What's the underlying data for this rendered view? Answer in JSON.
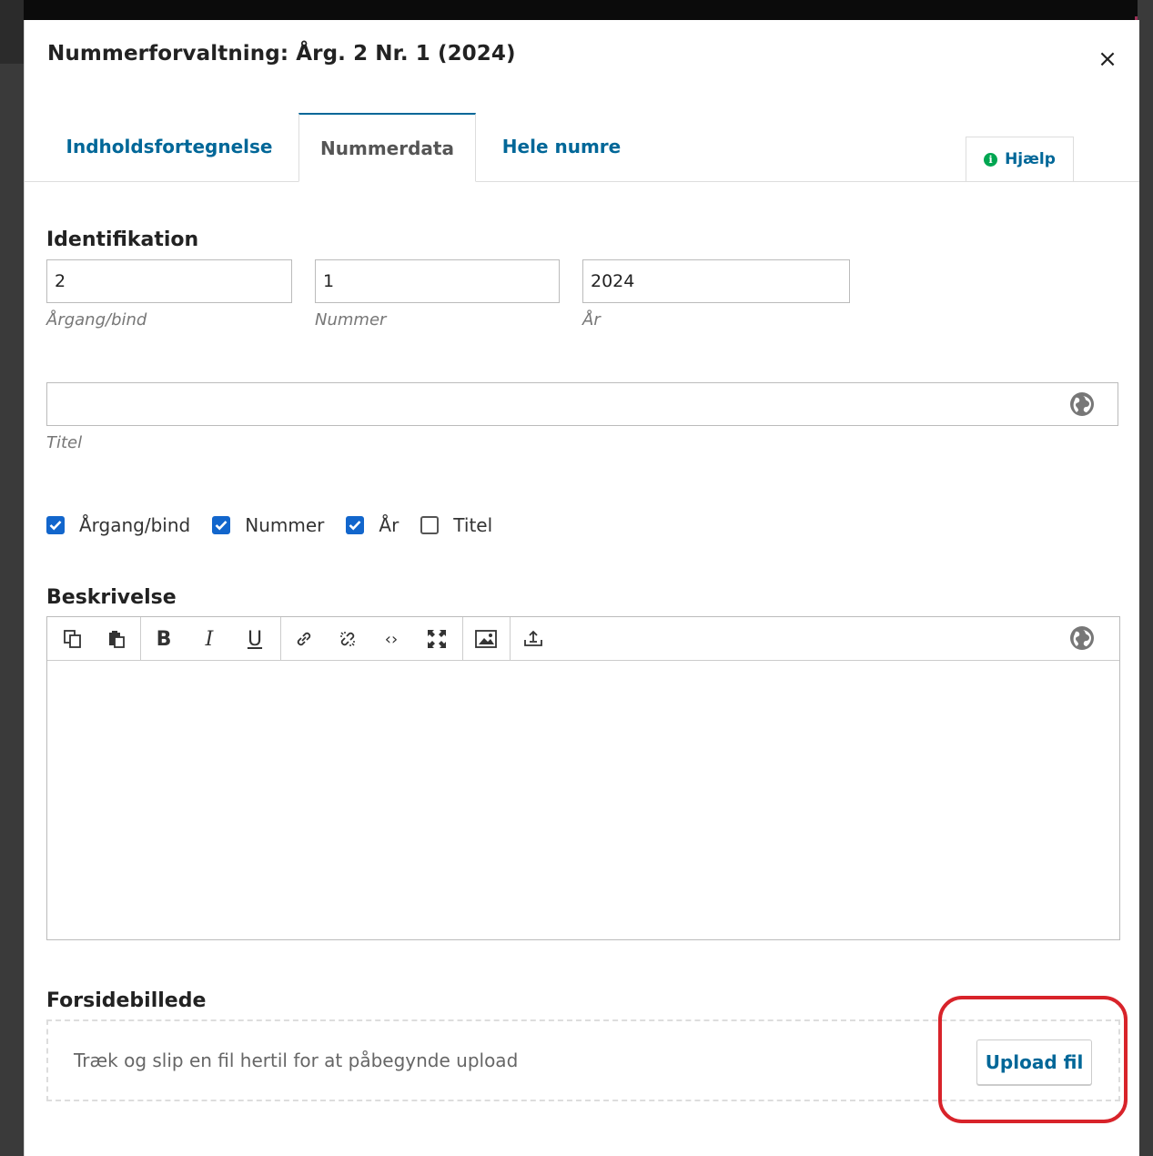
{
  "modal": {
    "title": "Nummerforvaltning: Årg. 2 Nr. 1 (2024)",
    "close_symbol": "×"
  },
  "tabs": [
    {
      "label": "Indholdsfortegnelse",
      "active": false
    },
    {
      "label": "Nummerdata",
      "active": true
    },
    {
      "label": "Hele numre",
      "active": false
    }
  ],
  "help": {
    "label": "Hjælp",
    "icon": "info-icon"
  },
  "identification": {
    "heading": "Identifikation",
    "volume": {
      "value": "2",
      "label": "Årgang/bind"
    },
    "number": {
      "value": "1",
      "label": "Nummer"
    },
    "year": {
      "value": "2024",
      "label": "År"
    },
    "title": {
      "value": "",
      "label": "Titel"
    }
  },
  "show_options": [
    {
      "label": "Årgang/bind",
      "checked": true
    },
    {
      "label": "Nummer",
      "checked": true
    },
    {
      "label": "År",
      "checked": true
    },
    {
      "label": "Titel",
      "checked": false
    }
  ],
  "description": {
    "heading": "Beskrivelse",
    "toolbar_icons": [
      "copy-icon",
      "paste-icon",
      "bold-icon",
      "italic-icon",
      "underline-icon",
      "link-icon",
      "unlink-icon",
      "code-icon",
      "fullscreen-icon",
      "image-icon",
      "upload-icon"
    ]
  },
  "cover_image": {
    "heading": "Forsidebillede",
    "drop_text": "Træk og slip en fil hertil for at påbegynde upload",
    "upload_label": "Upload fil"
  },
  "colors": {
    "link": "#006798",
    "checkbox": "#1266cc",
    "highlight": "#d8232a",
    "help_icon": "#00a651"
  }
}
